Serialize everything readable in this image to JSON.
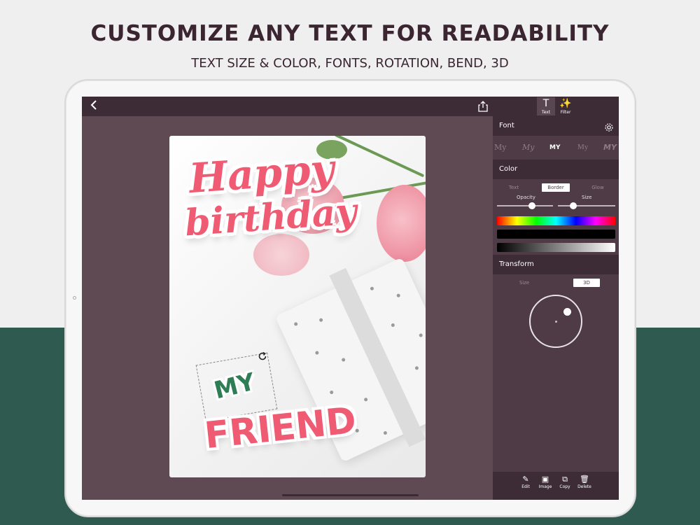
{
  "headline": "CUSTOMIZE ANY TEXT FOR READABILITY",
  "subline": "TEXT SIZE & COLOR, FONTS, ROTATION, BEND, 3D",
  "toolbar": {
    "text_label": "Text",
    "filter_label": "Filter"
  },
  "canvas": {
    "line1": "Happy",
    "line2": "birthday",
    "sticker_my": "MY",
    "sticker_friend": "FRIEND"
  },
  "panel": {
    "font_title": "Font",
    "font_samples": [
      "My",
      "My",
      "MY",
      "My",
      "MY"
    ],
    "color_title": "Color",
    "color_tabs": [
      "Text",
      "Border",
      "Glow"
    ],
    "color_tab_selected": "Border",
    "opacity_label": "Opacity",
    "size_label": "Size",
    "opacity_value": 0.62,
    "size_value": 0.27,
    "transform_title": "Transform",
    "transform_tabs": [
      "Size",
      "3D"
    ],
    "transform_tab_selected": "3D"
  },
  "bottom_actions": [
    "Edit",
    "Image",
    "Copy",
    "Delete"
  ],
  "colors": {
    "accent_pink": "#ef5b72",
    "accent_green": "#2e7d55",
    "panel_bg": "#4e3b45",
    "bottom_band": "#2f5a4f"
  }
}
